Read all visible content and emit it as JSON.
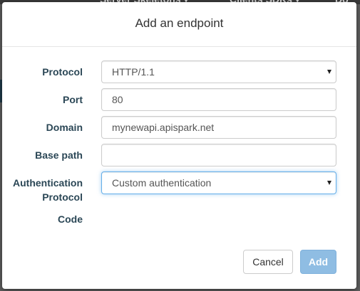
{
  "background": {
    "nav_items": [
      "Server Skeletons ▾",
      "Clients SDKs ▾",
      "Do"
    ]
  },
  "dialog": {
    "title": "Add an endpoint",
    "fields": {
      "protocol": {
        "label": "Protocol",
        "value": "HTTP/1.1"
      },
      "port": {
        "label": "Port",
        "value": "80"
      },
      "domain": {
        "label": "Domain",
        "value": "mynewapi.apispark.net"
      },
      "base_path": {
        "label": "Base path",
        "value": ""
      },
      "auth": {
        "label_line1": "Authentication",
        "label_line2": "Protocol",
        "value": "Custom authentication"
      },
      "code": {
        "label": "Code"
      }
    },
    "buttons": {
      "cancel": "Cancel",
      "add": "Add"
    }
  },
  "colors": {
    "label": "#2b4756",
    "primary_disabled": "#8fbde3",
    "focus_border": "#66afe9"
  }
}
